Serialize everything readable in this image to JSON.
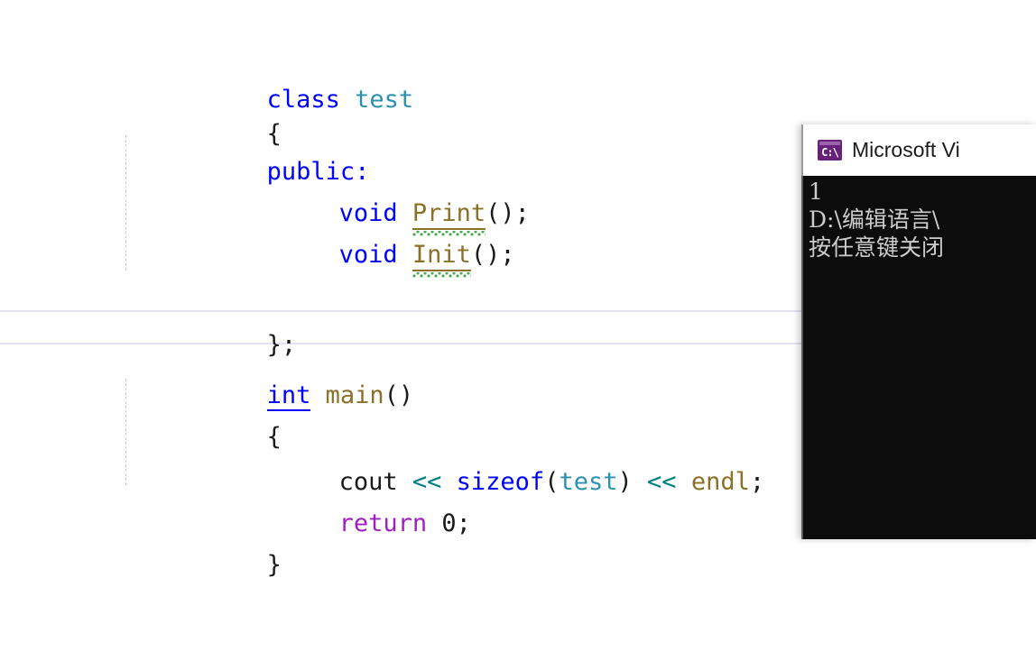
{
  "editor": {
    "name": "visual-studio-code-editor",
    "background": "#ffffff",
    "lines": [
      {
        "id": "l1",
        "indent": 0,
        "text": "class test"
      },
      {
        "id": "l2",
        "indent": 0,
        "text": "{"
      },
      {
        "id": "l3",
        "indent": 0,
        "text": "public:"
      },
      {
        "id": "l4",
        "indent": 1,
        "text": "void Print();"
      },
      {
        "id": "l5",
        "indent": 1,
        "text": "void Init();"
      },
      {
        "id": "l6",
        "indent": 0,
        "text": ""
      },
      {
        "id": "l7",
        "indent": 0,
        "text": "};"
      },
      {
        "id": "l8",
        "indent": 0,
        "text": "int main()"
      },
      {
        "id": "l9",
        "indent": 0,
        "text": "{"
      },
      {
        "id": "l10",
        "indent": 0,
        "text": ""
      },
      {
        "id": "l11",
        "indent": 1,
        "text": "cout << sizeof(test) << endl;"
      },
      {
        "id": "l12",
        "indent": 1,
        "text": "return 0;"
      },
      {
        "id": "l13",
        "indent": 0,
        "text": "}"
      }
    ],
    "tokens": {
      "kw_class": "class",
      "type_test": "test",
      "brace_open": "{",
      "brace_close": "}",
      "access_public": "public:",
      "kw_void": "void",
      "fn_print": "Print",
      "fn_init": "Init",
      "parens_semi": "();",
      "close_brace_semi": "};",
      "kw_int": "int",
      "fn_main": "main",
      "parens": "()",
      "id_cout": "cout",
      "op_shift": "<<",
      "kw_sizeof": "sizeof",
      "paren_l": "(",
      "paren_r": ")",
      "id_endl": "endl",
      "semi": ";",
      "kw_return": "return",
      "num_zero": "0"
    },
    "current_line": "int main()",
    "colors": {
      "keyword": "#0000ff",
      "user_type": "#2b91af",
      "function": "#8b7028",
      "operator": "#008080",
      "control_keyword": "#a020c0",
      "plain_text": "#1a1a1a",
      "error_squiggle": "#4caf50",
      "current_line_border": "#e2e3ef",
      "indent_guide": "#c9c9c9"
    }
  },
  "console": {
    "name": "microsoft-visual-studio-debug-console",
    "title": "Microsoft Vi",
    "icon": "command-prompt-icon",
    "icon_glyph": "C:\\",
    "icon_color": "#68217a",
    "background": "#0c0c0c",
    "text_color": "#cccccc",
    "lines": [
      "1",
      "",
      "D:\\编辑语言\\",
      "按任意键关闭"
    ]
  }
}
